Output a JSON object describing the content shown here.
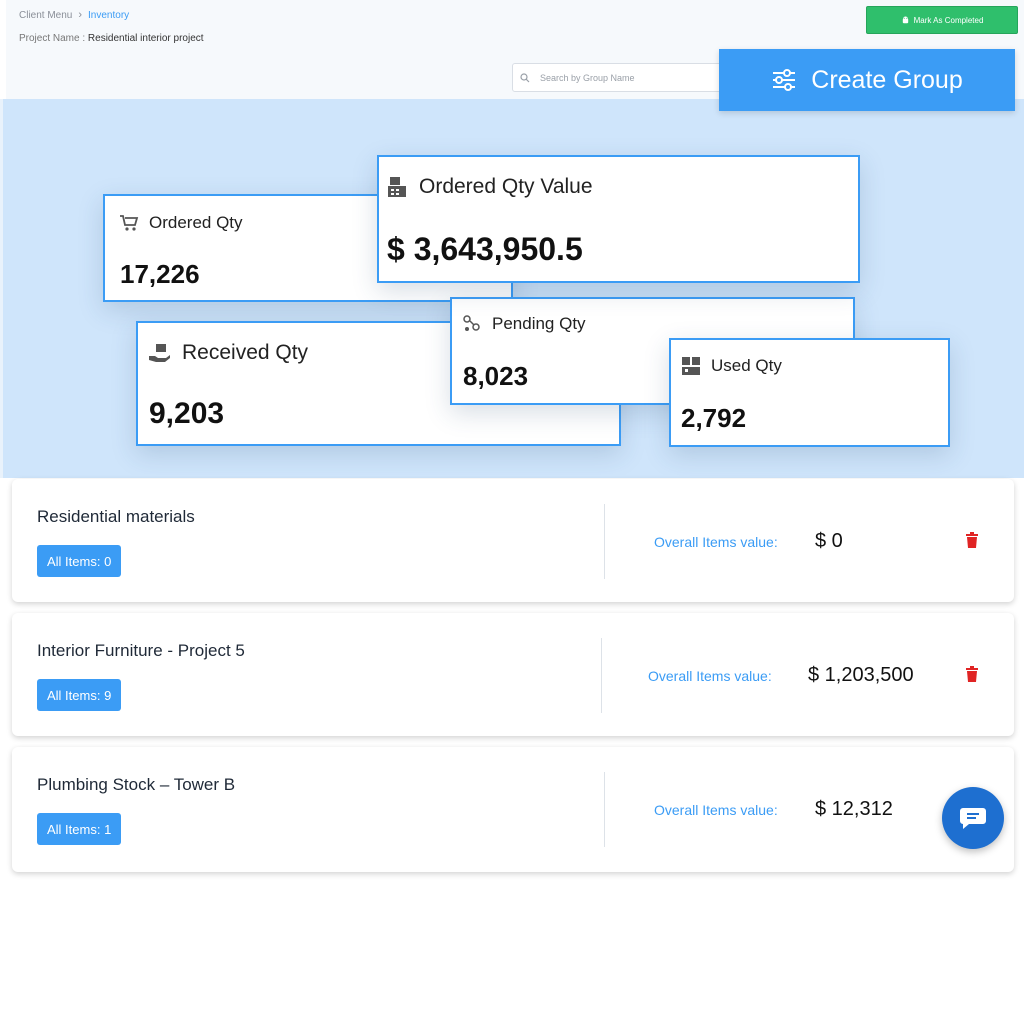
{
  "breadcrumb": {
    "parent": "Client Menu",
    "current": "Inventory"
  },
  "project": {
    "label": "Project Name :",
    "name": "Residential interior project"
  },
  "actions": {
    "mark_completed": "Mark As Completed",
    "create_group": "Create Group"
  },
  "search": {
    "placeholder": "Search by Group Name"
  },
  "stats": {
    "ordered_qty": {
      "label": "Ordered Qty",
      "value": "17,226"
    },
    "ordered_qty_value": {
      "label": "Ordered Qty Value",
      "value": "$ 3,643,950.5"
    },
    "received_qty": {
      "label": "Received Qty",
      "value": "9,203"
    },
    "pending_qty": {
      "label": "Pending Qty",
      "value": "8,023"
    },
    "used_qty": {
      "label": "Used Qty",
      "value": "2,792"
    }
  },
  "groups": [
    {
      "name": "Residential materials",
      "items_badge": "All Items: 0",
      "value_label": "Overall Items value:",
      "value": "$ 0"
    },
    {
      "name": "Interior Furniture - Project 5",
      "items_badge": "All Items: 9",
      "value_label": "Overall Items value:",
      "value": "$ 1,203,500"
    },
    {
      "name": "Plumbing Stock – Tower B",
      "items_badge": "All Items: 1",
      "value_label": "Overall Items value:",
      "value": "$ 12,312"
    }
  ],
  "colors": {
    "accent": "#3b9cf5",
    "success": "#2fbf6c",
    "danger": "#e02424",
    "stats_bg": "#cfe5fb",
    "chat": "#1e6fd0"
  },
  "icons": [
    "chevron-right-icon",
    "android-icon",
    "search-icon",
    "sliders-icon",
    "cart-icon",
    "cash-register-icon",
    "hand-receive-icon",
    "pending-icon",
    "used-icon",
    "trash-icon",
    "chat-icon"
  ]
}
